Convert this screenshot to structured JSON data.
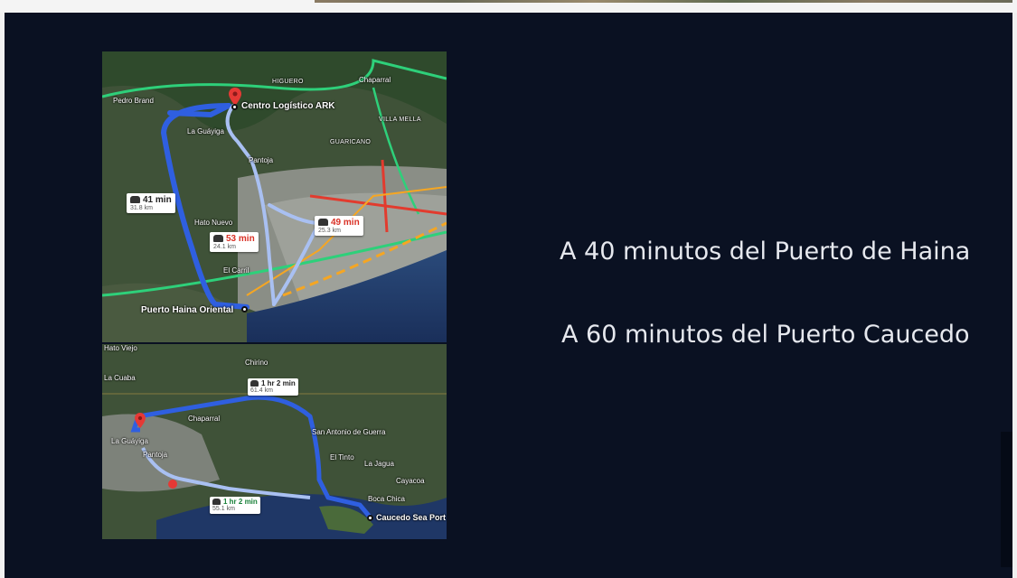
{
  "slide": {
    "captions": [
      "A 40 minutos del Puerto de Haina",
      "A 60 minutos del Puerto Caucedo"
    ]
  },
  "map_top": {
    "places": {
      "pedro_brand": "Pedro Brand",
      "higuero": "HIGUERO",
      "chaparral": "Chaparral",
      "villa_mella": "VILLA MELLA",
      "guaricano": "GUARICANO",
      "la_guayiga": "La Guáyiga",
      "pantoja": "Pantoja",
      "hato_nuevo": "Hato Nuevo",
      "el_carril": "El Carril",
      "destination": "Centro Logístico ARK",
      "origin": "Puerto Haina Oriental"
    },
    "routes": [
      {
        "time": "41 min",
        "distance": "31.8 km"
      },
      {
        "time": "53 min",
        "distance": "24.1 km"
      },
      {
        "time": "49 min",
        "distance": "25.3 km"
      }
    ],
    "colors": {
      "primary_route": "#2f5fe0",
      "alt_route": "#a9c0f2",
      "highway": "#2ed07a",
      "traffic_red": "#e23b2e",
      "traffic_orange": "#f5a623"
    }
  },
  "map_bottom": {
    "places": {
      "hato_viejo": "Hato Viejo",
      "la_cuaba": "La Cuaba",
      "chirino": "Chirino",
      "chaparral": "Chaparral",
      "la_guayiga": "La Guáyiga",
      "pantoja": "Pantoja",
      "san_antonio": "San Antonio de Guerra",
      "el_tinto": "El Tinto",
      "la_jagua": "La Jagua",
      "cayacoa": "Cayacoa",
      "boca_chica": "Boca Chica",
      "destination": "Caucedo Sea Port"
    },
    "routes": [
      {
        "time": "1 hr 2 min",
        "distance": "61.4 km"
      },
      {
        "time": "1 hr 2 min",
        "distance": "55.1 km"
      }
    ]
  }
}
